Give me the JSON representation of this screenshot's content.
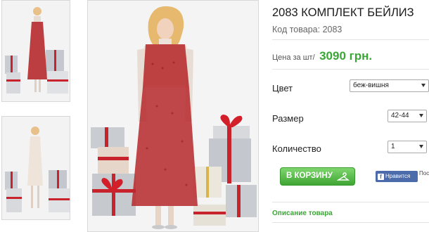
{
  "product": {
    "title": "2083 КОМПЛЕКТ БЕЙЛИЗ",
    "code_label": "Код товара:",
    "code_value": "2083"
  },
  "price": {
    "label": "Цена за шт/",
    "value": "3090 грн."
  },
  "options": {
    "color_label": "Цвет",
    "color_value": "беж-вишня",
    "size_label": "Размер",
    "size_value": "42-44",
    "quantity_label": "Количество",
    "quantity_value": "1"
  },
  "cart": {
    "button_label": "В КОРЗИНУ"
  },
  "social": {
    "like_label": "Нравится",
    "like_side_text": "Пост свою"
  },
  "description": {
    "title": "Описание товара"
  },
  "colors": {
    "accent_green": "#3aa635",
    "dress_red": "#b72a2c",
    "facebook_blue": "#4b6bab"
  }
}
